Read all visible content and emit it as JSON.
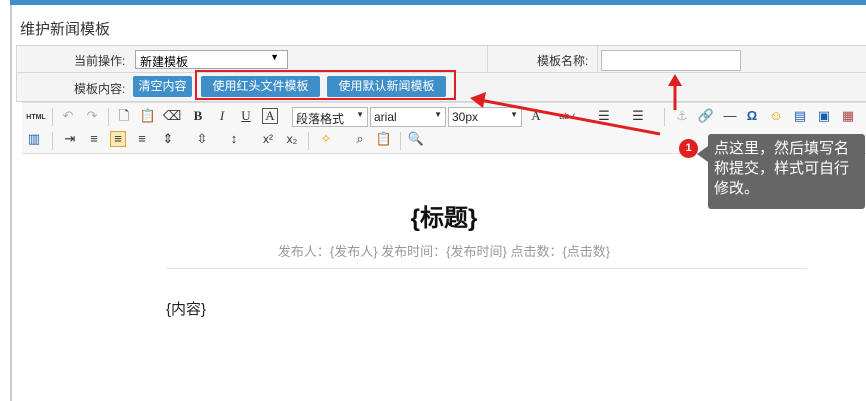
{
  "title": "维护新闻模板",
  "form": {
    "op_label": "当前操作:",
    "op_value": "新建模板",
    "name_label": "模板名称:",
    "name_value": "",
    "content_label": "模板内容:",
    "clear_btn": "清空内容",
    "red_template_btn": "使用红头文件模板",
    "default_template_btn": "使用默认新闻模板"
  },
  "toolbar": {
    "html_label": "HTML",
    "paragraph": "段落格式",
    "font": "arial",
    "size": "30px"
  },
  "editor": {
    "doc_title": "{标题}",
    "meta": "发布人：{发布人}   发布时间：{发布时间}   点击数：{点击数}",
    "content": "{内容}"
  },
  "annotation": {
    "badge": "1",
    "text": "点这里，然后填写名称提交，样式可自行修改。"
  },
  "colors": {
    "accent": "#3d8ec9",
    "annotation_red": "#e02020",
    "tooltip_bg": "#666666"
  }
}
